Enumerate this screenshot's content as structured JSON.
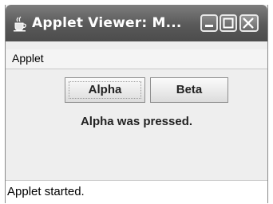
{
  "window": {
    "title": "Applet Viewer: M...",
    "icon": "java-cup-icon",
    "controls": [
      "minimize-icon",
      "maximize-icon",
      "close-icon"
    ]
  },
  "menubar": {
    "items": [
      {
        "label": "Applet"
      }
    ]
  },
  "applet": {
    "buttons": [
      {
        "label": "Alpha",
        "focused": true
      },
      {
        "label": "Beta",
        "focused": false
      }
    ],
    "message": "Alpha was pressed."
  },
  "status": {
    "text": "Applet started."
  }
}
